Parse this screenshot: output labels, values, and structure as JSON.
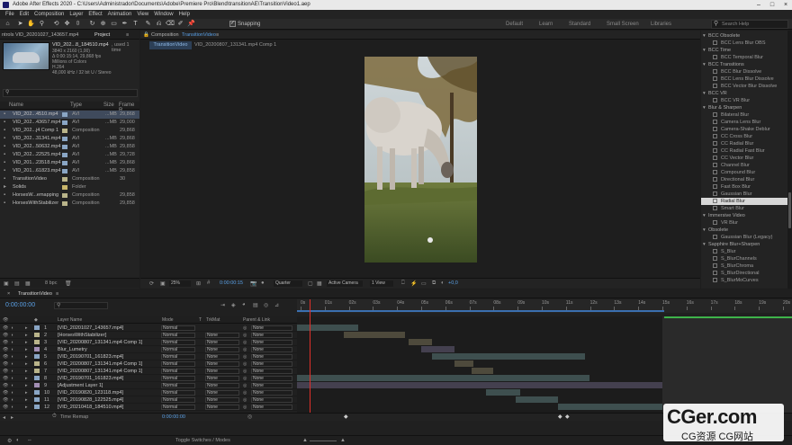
{
  "titlebar": {
    "text": "Adobe After Effects 2020 - C:\\Users\\Administrador\\Documents\\Adobe\\Premiere Pro\\Blend\\transitionAE\\TransitionVideo1.aep"
  },
  "menu": [
    "File",
    "Edit",
    "Composition",
    "Layer",
    "Effect",
    "Animation",
    "View",
    "Window",
    "Help"
  ],
  "toolbar": {
    "snapping": "Snapping",
    "workspaces": [
      "Default",
      "Learn",
      "Standard",
      "Small Screen",
      "Libraries"
    ],
    "search_help": "Search Help"
  },
  "project": {
    "tab_effects": "ntrols VID_20201027_143657.mp4",
    "tab_project": "Project",
    "sel_name": "VID_202...8_184510.mp4",
    "sel_used": ", used 1 time",
    "info": [
      "3840 x 2160 (1,00)",
      "Δ 0:00:15:14, 29,868 fps",
      "Millions of Colors",
      "H.264",
      "48,000 kHz / 32 bit U / Stereo"
    ],
    "cols": {
      "name": "Name",
      "type": "Type",
      "size": "Size",
      "frame": "Frame R..."
    },
    "items": [
      {
        "name": "VID_202...4510.mp4",
        "type": "AVI",
        "size": "...MB",
        "fr": "29,868",
        "color": "#8aa6c5",
        "sel": true
      },
      {
        "name": "VID_202...43657.mp4",
        "type": "AVI",
        "size": "...MB",
        "fr": "29,000",
        "color": "#8aa6c5"
      },
      {
        "name": "VID_202...j4 Comp 1",
        "type": "Composition",
        "size": "",
        "fr": "29,868",
        "color": "#b9b48a"
      },
      {
        "name": "VID_202...31341.mp4",
        "type": "AVI",
        "size": "...MB",
        "fr": "29,868",
        "color": "#8aa6c5"
      },
      {
        "name": "VID_202...50632.mp4",
        "type": "AVI",
        "size": "...MB",
        "fr": "29,858",
        "color": "#8aa6c5"
      },
      {
        "name": "VID_202...22525.mp4",
        "type": "AVI",
        "size": "...MB",
        "fr": "29,728",
        "color": "#8aa6c5"
      },
      {
        "name": "VID_201...23518.mp4",
        "type": "AVI",
        "size": "...MB",
        "fr": "29,868",
        "color": "#8aa6c5"
      },
      {
        "name": "VID_201...61823.mp4",
        "type": "AVI",
        "size": "...MB",
        "fr": "29,858",
        "color": "#8aa6c5"
      },
      {
        "name": "TransitionVideo",
        "type": "Composition",
        "size": "",
        "fr": "30",
        "color": "#b9b48a"
      },
      {
        "name": "Solids",
        "type": "Folder",
        "size": "",
        "fr": "",
        "color": "#c9b66a"
      },
      {
        "name": "HorsesW...emapping",
        "type": "Composition",
        "size": "",
        "fr": "29,858",
        "color": "#b9b48a"
      },
      {
        "name": "HorsesWithStabilizer",
        "type": "Composition",
        "size": "",
        "fr": "29,858",
        "color": "#b9b48a"
      }
    ],
    "footer_bpc": "8 bpc"
  },
  "composition": {
    "panel_tab": "Composition",
    "panel_tab_name": "TransitionVideo",
    "subtab_active": "TransitionVideo",
    "subtab_other": "VID_20200807_131341.mp4 Comp 1",
    "zoom": "25%",
    "timecode": "0:00:00:15",
    "resolution": "Quarter",
    "camera": "Active Camera",
    "views": "1 View",
    "exposure": "+0,0"
  },
  "effects": {
    "items": [
      {
        "t": "cat",
        "label": "BCC Obsolete"
      },
      {
        "t": "fx",
        "label": "BCC Lens Blur OBS"
      },
      {
        "t": "cat",
        "label": "BCC Time"
      },
      {
        "t": "fx",
        "label": "BCC Temporal Blur"
      },
      {
        "t": "cat",
        "label": "BCC Transitions"
      },
      {
        "t": "fx",
        "label": "BCC Blur Dissolve"
      },
      {
        "t": "fx",
        "label": "BCC Lens Blur Dissolve"
      },
      {
        "t": "fx",
        "label": "BCC Vector Blur Dissolve"
      },
      {
        "t": "cat",
        "label": "BCC VR"
      },
      {
        "t": "fx",
        "label": "BCC VR Blur"
      },
      {
        "t": "cat",
        "label": "Blur & Sharpen"
      },
      {
        "t": "fx",
        "label": "Bilateral Blur"
      },
      {
        "t": "fx",
        "label": "Camera Lens Blur"
      },
      {
        "t": "fx",
        "label": "Camera-Shake Deblur"
      },
      {
        "t": "fx",
        "label": "CC Cross Blur"
      },
      {
        "t": "fx",
        "label": "CC Radial Blur"
      },
      {
        "t": "fx",
        "label": "CC Radial Fast Blur"
      },
      {
        "t": "fx",
        "label": "CC Vector Blur"
      },
      {
        "t": "fx",
        "label": "Channel Blur"
      },
      {
        "t": "fx",
        "label": "Compound Blur"
      },
      {
        "t": "fx",
        "label": "Directional Blur"
      },
      {
        "t": "fx",
        "label": "Fast Box Blur"
      },
      {
        "t": "fx",
        "label": "Gaussian Blur"
      },
      {
        "t": "fx",
        "label": "Radial Blur",
        "sel": true
      },
      {
        "t": "fx",
        "label": "Smart Blur"
      },
      {
        "t": "cat",
        "label": "Immersive Video"
      },
      {
        "t": "fx",
        "label": "VR Blur"
      },
      {
        "t": "cat",
        "label": "Obsolete"
      },
      {
        "t": "fx",
        "label": "Gaussian Blur (Legacy)"
      },
      {
        "t": "cat",
        "label": "Sapphire Blur+Sharpen"
      },
      {
        "t": "fx",
        "label": "S_Blur"
      },
      {
        "t": "fx",
        "label": "S_BlurChannels"
      },
      {
        "t": "fx",
        "label": "S_BlurChroma"
      },
      {
        "t": "fx",
        "label": "S_BlurDirectional"
      },
      {
        "t": "fx",
        "label": "S_BlurMoCurves"
      }
    ]
  },
  "timeline": {
    "tab": "TransitionVideo",
    "timecode": "0:00:00:00",
    "cols": {
      "layer_name": "Layer Name",
      "mode": "Mode",
      "t": "T",
      "trkmat": "TrkMat",
      "parent": "Parent & Link"
    },
    "mode_value": "Normal",
    "none_value": "None",
    "layers": [
      {
        "n": "1",
        "name": "[VID_20201027_143657.mp4]",
        "color": "#8aa6c5"
      },
      {
        "n": "2",
        "name": "[HorsesWithStabilizer]",
        "color": "#b9b48a"
      },
      {
        "n": "3",
        "name": "[VID_20200807_131341.mp4 Comp 1]",
        "color": "#b9b48a"
      },
      {
        "n": "4",
        "name": "Blur_Lumetry",
        "color": "#a38fb5"
      },
      {
        "n": "5",
        "name": "[VID_20190701_161823.mp4]",
        "color": "#8aa6c5"
      },
      {
        "n": "6",
        "name": "[VID_20200807_131341.mp4 Comp 1]",
        "color": "#b9b48a"
      },
      {
        "n": "7",
        "name": "[VID_20200807_131341.mp4 Comp 1]",
        "color": "#b9b48a"
      },
      {
        "n": "8",
        "name": "[VID_20190701_161823.mp4]",
        "color": "#8aa6c5"
      },
      {
        "n": "9",
        "name": "[Adjustment Layer 1]",
        "color": "#a38fb5"
      },
      {
        "n": "10",
        "name": "[VID_20190820_123118.mp4]",
        "color": "#8aa6c5"
      },
      {
        "n": "11",
        "name": "[VID_20190828_122525.mp4]",
        "color": "#8aa6c5"
      },
      {
        "n": "12",
        "name": "[VID_20210418_184510.mp4]",
        "color": "#8aa6c5"
      }
    ],
    "time_remap": "Time Remap",
    "time_remap_value": "0:00:00:00",
    "ruler": [
      "0s",
      "01s",
      "02s",
      "03s",
      "04s",
      "05s",
      "06s",
      "07s",
      "08s",
      "09s",
      "10s",
      "11s",
      "12s",
      "13s",
      "14s",
      "15s",
      "16s",
      "17s",
      "18s",
      "19s",
      "20s"
    ],
    "toggle": "Toggle Switches / Modes"
  },
  "watermark": {
    "logo": "CGer.com",
    "sub": "CG资源 CG网站"
  }
}
